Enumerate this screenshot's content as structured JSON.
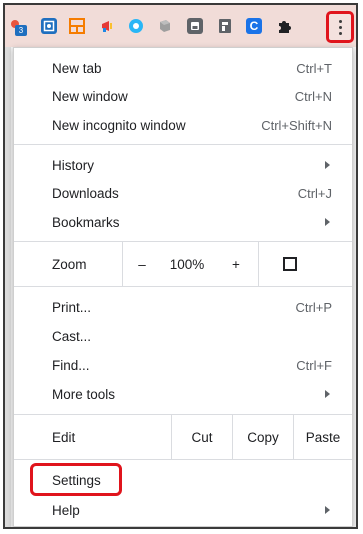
{
  "toolbar": {
    "badge_count": "3",
    "extensions": [
      {
        "name": "tab-manager-icon",
        "color": "#e8553d"
      },
      {
        "name": "screenshot-icon",
        "color": "#1f6fbf"
      },
      {
        "name": "grid-icon",
        "color": "#f57c00"
      },
      {
        "name": "megaphone-icon",
        "color": "#e53935"
      },
      {
        "name": "globe-icon",
        "color": "#29b6f6"
      },
      {
        "name": "puzzle-box-icon",
        "color": "#8a8a8a"
      },
      {
        "name": "save-icon",
        "color": "#5f6368"
      },
      {
        "name": "flipboard-icon",
        "color": "#5f6368"
      },
      {
        "name": "c-extension-icon",
        "color": "#1a73e8"
      },
      {
        "name": "extensions-puzzle-icon",
        "color": "#202124"
      }
    ],
    "menu_button_icon": "kebab-menu-icon"
  },
  "menu": {
    "new_tab": {
      "label": "New tab",
      "shortcut": "Ctrl+T"
    },
    "new_window": {
      "label": "New window",
      "shortcut": "Ctrl+N"
    },
    "new_incognito": {
      "label": "New incognito window",
      "shortcut": "Ctrl+Shift+N"
    },
    "history": {
      "label": "History"
    },
    "downloads": {
      "label": "Downloads",
      "shortcut": "Ctrl+J"
    },
    "bookmarks": {
      "label": "Bookmarks"
    },
    "zoom": {
      "label": "Zoom",
      "minus": "–",
      "level": "100%",
      "plus": "+"
    },
    "print": {
      "label": "Print...",
      "shortcut": "Ctrl+P"
    },
    "cast": {
      "label": "Cast..."
    },
    "find": {
      "label": "Find...",
      "shortcut": "Ctrl+F"
    },
    "more_tools": {
      "label": "More tools"
    },
    "edit": {
      "label": "Edit",
      "cut": "Cut",
      "copy": "Copy",
      "paste": "Paste"
    },
    "settings": {
      "label": "Settings"
    },
    "help": {
      "label": "Help"
    }
  },
  "colors": {
    "highlight": "#e0141c",
    "toolbar_bg": "#f1dcd8"
  }
}
